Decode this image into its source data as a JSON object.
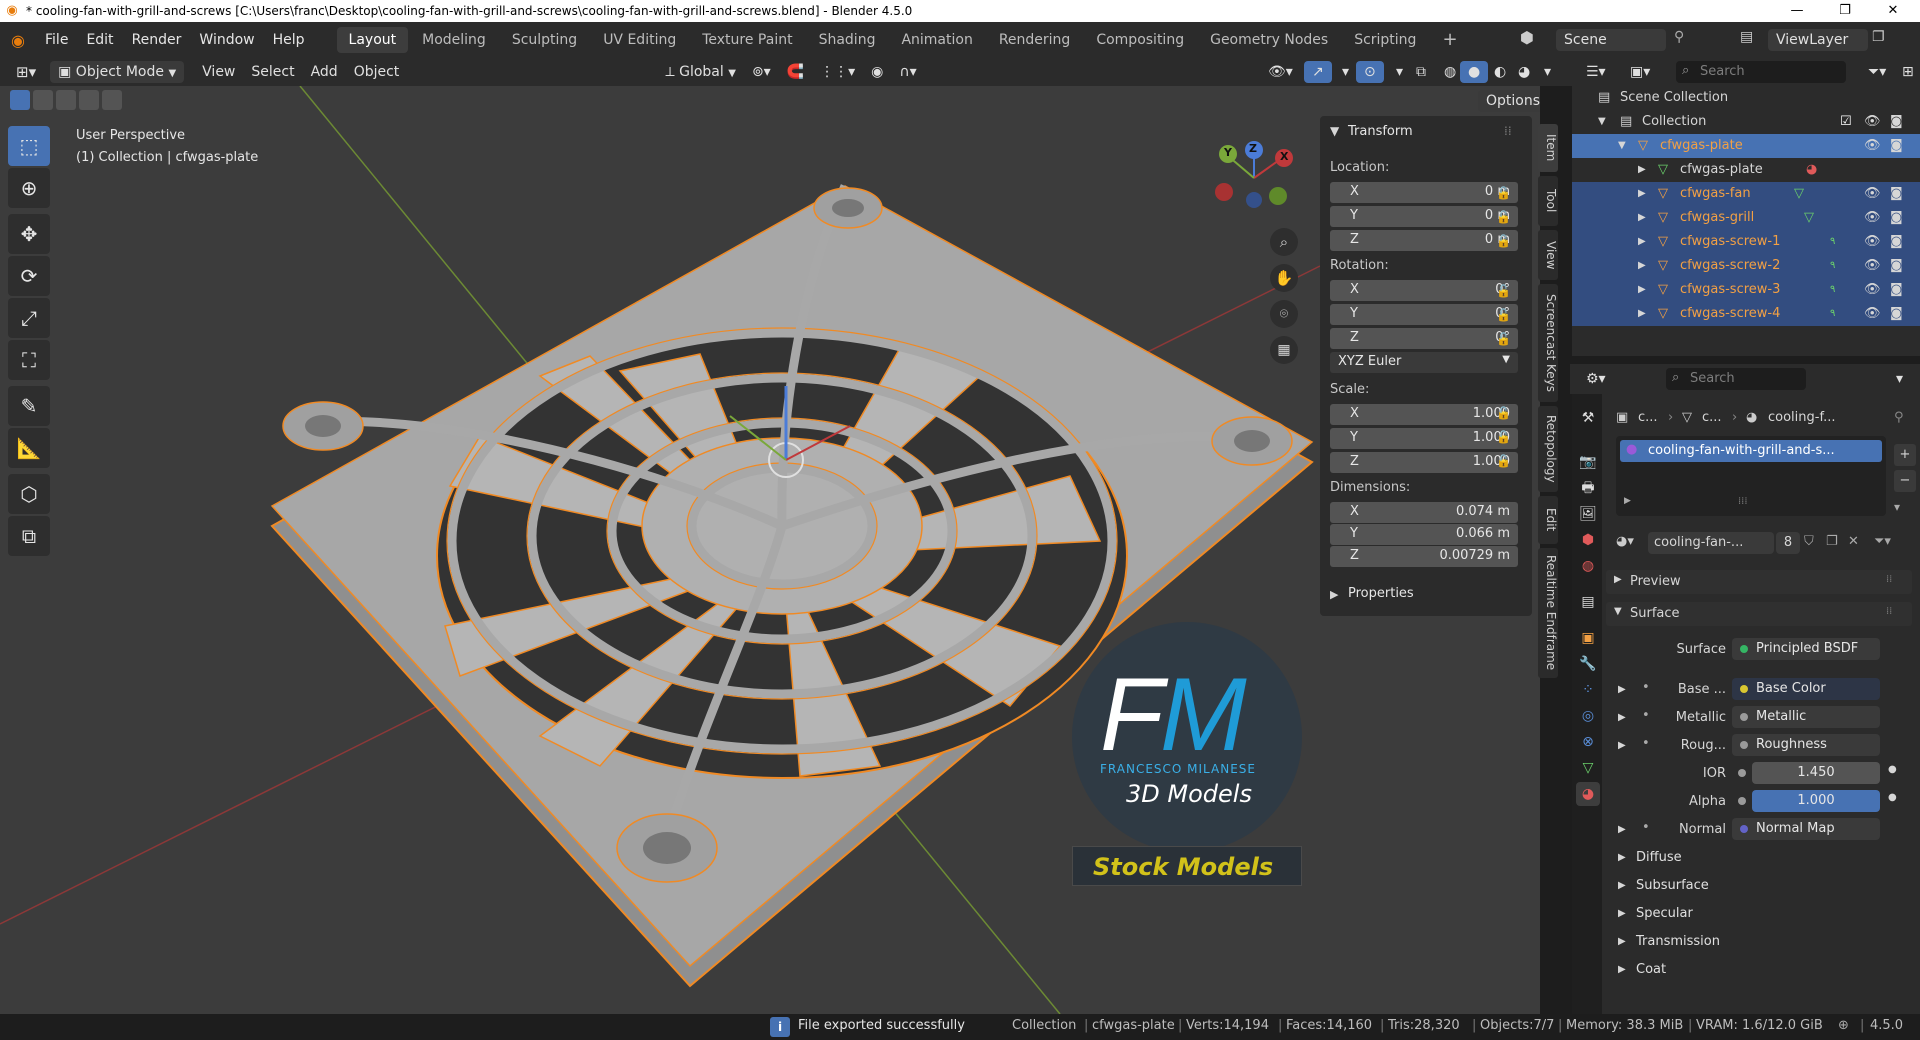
{
  "window": {
    "title": "* cooling-fan-with-grill-and-screws [C:\\Users\\franc\\Desktop\\cooling-fan-with-grill-and-screws\\cooling-fan-with-grill-and-screws.blend] - Blender 4.5.0",
    "minimize": "—",
    "maximize": "❐",
    "close": "✕"
  },
  "menu": [
    "File",
    "Edit",
    "Render",
    "Window",
    "Help"
  ],
  "workspaces": [
    "Layout",
    "Modeling",
    "Sculpting",
    "UV Editing",
    "Texture Paint",
    "Shading",
    "Animation",
    "Rendering",
    "Compositing",
    "Geometry Nodes",
    "Scripting"
  ],
  "add_workspace": "+",
  "scene": {
    "scene_label": "Scene",
    "viewlayer_label": "ViewLayer"
  },
  "viewport_header": {
    "mode": "Object Mode",
    "menus": [
      "View",
      "Select",
      "Add",
      "Object"
    ],
    "transform_orientation": "Global",
    "options": "Options"
  },
  "viewport": {
    "perspective": "User Perspective",
    "collection_info": "(1) Collection | cfwgas-plate",
    "gizmo": {
      "x": "X",
      "y": "Y",
      "z": "Z"
    },
    "colors": {
      "bg": "#3c3c3c",
      "selection": "#f08a24",
      "model": "#a7a7a7",
      "x_axis": "#c0393b",
      "y_axis": "#7aa83a"
    }
  },
  "watermark": {
    "logo_f": "F",
    "logo_m": "M",
    "author": "FRANCESCO MILANESE",
    "subtitle": "3D Models",
    "stock": "Stock Models",
    "colors": {
      "m": "#1f9bd7",
      "stock": "#d2c21a"
    }
  },
  "transform": {
    "title": "Transform",
    "location_label": "Location:",
    "location": [
      {
        "axis": "X",
        "value": "0 m"
      },
      {
        "axis": "Y",
        "value": "0 m"
      },
      {
        "axis": "Z",
        "value": "0 m"
      }
    ],
    "rotation_label": "Rotation:",
    "rotation": [
      {
        "axis": "X",
        "value": "0°"
      },
      {
        "axis": "Y",
        "value": "0°"
      },
      {
        "axis": "Z",
        "value": "0°"
      }
    ],
    "rotation_mode": "XYZ Euler",
    "scale_label": "Scale:",
    "scale": [
      {
        "axis": "X",
        "value": "1.000"
      },
      {
        "axis": "Y",
        "value": "1.000"
      },
      {
        "axis": "Z",
        "value": "1.000"
      }
    ],
    "dimensions_label": "Dimensions:",
    "dimensions": [
      {
        "axis": "X",
        "value": "0.074 m"
      },
      {
        "axis": "Y",
        "value": "0.066 m"
      },
      {
        "axis": "Z",
        "value": "0.00729 m"
      }
    ],
    "properties": "Properties"
  },
  "side_tabs": [
    "Item",
    "Tool",
    "View",
    "Screencast Keys",
    "Retopology",
    "Edit",
    "Realtime Endframe"
  ],
  "outliner": {
    "search_placeholder": "Search",
    "scene_collection": "Scene Collection",
    "collection": "Collection",
    "items": [
      {
        "name": "cfwgas-plate",
        "type": "object",
        "level": 1,
        "state": "active"
      },
      {
        "name": "cfwgas-plate",
        "type": "mesh",
        "level": 2,
        "state": "normal"
      },
      {
        "name": "cfwgas-fan",
        "type": "object",
        "level": 2,
        "state": "selected"
      },
      {
        "name": "cfwgas-grill",
        "type": "object",
        "level": 2,
        "state": "selected"
      },
      {
        "name": "cfwgas-screw-1",
        "type": "object",
        "level": 2,
        "state": "selected"
      },
      {
        "name": "cfwgas-screw-2",
        "type": "object",
        "level": 2,
        "state": "selected"
      },
      {
        "name": "cfwgas-screw-3",
        "type": "object",
        "level": 2,
        "state": "selected"
      },
      {
        "name": "cfwgas-screw-4",
        "type": "object",
        "level": 2,
        "state": "selected"
      }
    ]
  },
  "properties": {
    "search_placeholder": "Search",
    "breadcrumb": [
      "c...",
      "c...",
      "cooling-f..."
    ],
    "material_slot": "cooling-fan-with-grill-and-s...",
    "material_name": "cooling-fan-...",
    "users": "8",
    "sections": {
      "preview": "Preview",
      "surface": "Surface"
    },
    "surface_label": "Surface",
    "surface_value": "Principled BSDF",
    "inputs": [
      {
        "label": "Base ...",
        "value": "Base Color",
        "dot": "#d8c631",
        "kind": "link"
      },
      {
        "label": "Metallic",
        "value": "Metallic",
        "dot": "#9a9a9a",
        "kind": "link"
      },
      {
        "label": "Roug...",
        "value": "Roughness",
        "dot": "#9a9a9a",
        "kind": "link"
      },
      {
        "label": "IOR",
        "value": "1.450",
        "dot": "#9a9a9a",
        "kind": "number"
      },
      {
        "label": "Alpha",
        "value": "1.000",
        "dot": "#9a9a9a",
        "kind": "slider",
        "fill": 1.0
      },
      {
        "label": "Normal",
        "value": "Normal Map",
        "dot": "#6363c7",
        "kind": "link"
      }
    ],
    "subsections": [
      "Diffuse",
      "Subsurface",
      "Specular",
      "Transmission",
      "Coat"
    ]
  },
  "status": {
    "message": "File exported successfully",
    "collection": "Collection",
    "object": "cfwgas-plate",
    "verts": "Verts:14,194",
    "faces": "Faces:14,160",
    "tris": "Tris:28,320",
    "objects": "Objects:7/7",
    "memory": "Memory: 38.3 MiB",
    "vram": "VRAM: 1.6/12.0 GiB",
    "version": "4.5.0"
  }
}
